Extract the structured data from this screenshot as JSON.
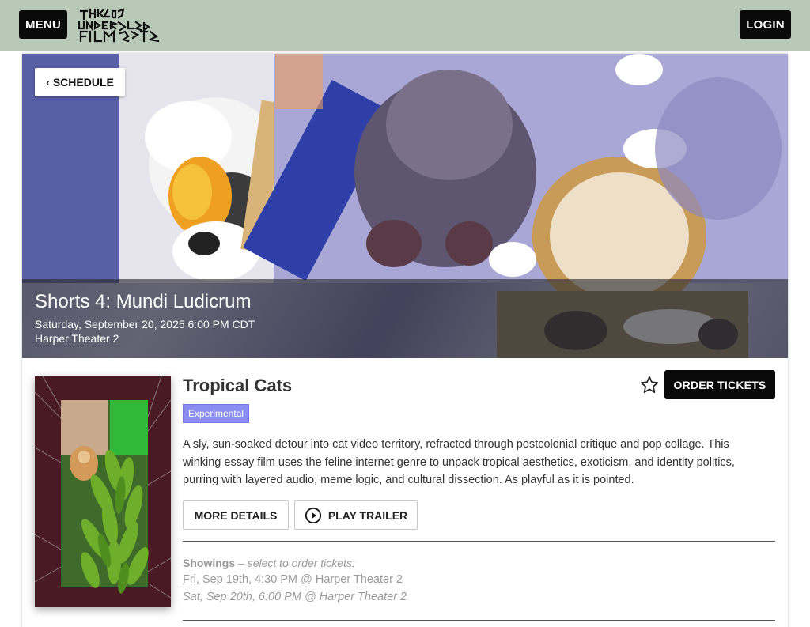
{
  "header": {
    "menu_label": "MENU",
    "login_label": "LOGIN",
    "logo_text": "Chicago Underground Film Fest",
    "background_color": "#b8c9b8"
  },
  "hero": {
    "back_label": "SCHEDULE",
    "back_icon": "chevron-left-icon",
    "program_title": "Shorts 4: Mundi Ludicrum",
    "datetime": "Saturday, September 20, 2025 6:00 PM CDT",
    "venue": "Harper Theater 2"
  },
  "film": {
    "title": "Tropical Cats",
    "genre": "Experimental",
    "favorite_icon": "star-outline-icon",
    "order_label": "ORDER TICKETS",
    "description": "A sly, sun-soaked detour into cat video territory, refracted through postcolonial critique and pop collage. This winking essay film uses the feline internet genre to unpack tropical aesthetics, exoticism, and identity politics, purring with layered audio, meme logic, and cultural dissection. As playful as it is pointed.",
    "more_details_label": "MORE DETAILS",
    "play_trailer_label": "PLAY TRAILER",
    "play_icon": "play-circle-icon",
    "genre_color": "#8b8df0"
  },
  "showings": {
    "heading": "Showings",
    "subheading": "– select to order tickets:",
    "items": [
      {
        "label": "Fri, Sep 19th, 4:30 PM @ Harper Theater 2",
        "selectable": true
      },
      {
        "label": "Sat, Sep 20th, 6:00 PM @ Harper Theater 2",
        "selectable": false
      }
    ]
  }
}
